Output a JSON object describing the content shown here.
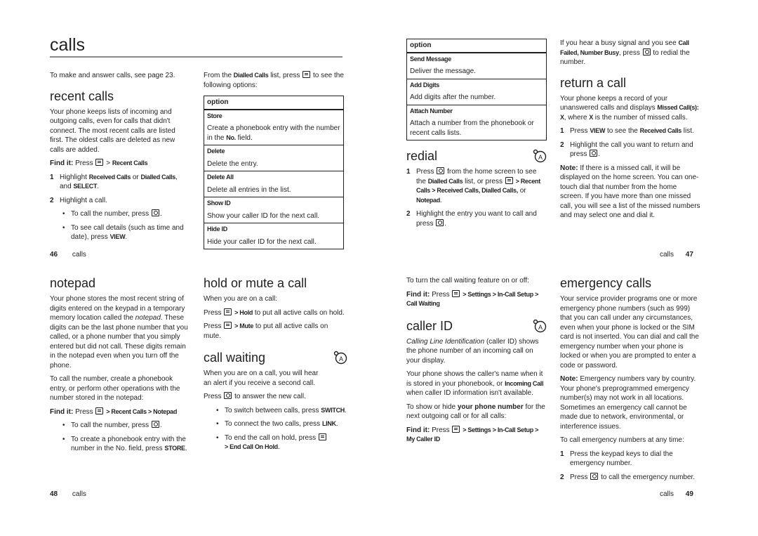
{
  "page46": {
    "title": "calls",
    "intro": "To make and answer calls, see page 23.",
    "recent_calls": {
      "heading": "recent calls",
      "body": "Your phone keeps lists of incoming and outgoing calls, even for calls that didn't connect. The most recent calls are listed first. The oldest calls are deleted as new calls are added.",
      "find_it_label": "Find it:",
      "find_it_press": "Press",
      "find_it_path": "Recent Calls",
      "step1_num": "1",
      "step1_a": "Highlight",
      "step1_b": "Received Calls",
      "step1_c": "or",
      "step1_d": "Dialled Calls",
      "step1_e": ", and",
      "step1_f": "SELECT",
      "step2_num": "2",
      "step2": "Highlight a call.",
      "bullet1": "To call the number, press",
      "bullet2_a": "To see call details (such as time and date), press",
      "bullet2_b": "VIEW"
    },
    "dialled_options": {
      "intro_a": "From the",
      "intro_b": "Dialled Calls",
      "intro_c": "list, press",
      "intro_d": "to see the following options:",
      "header": "option",
      "rows": [
        {
          "name": "Store",
          "desc_a": "Create a phonebook entry with the number in the",
          "desc_b": "No.",
          "desc_c": "field."
        },
        {
          "name": "Delete",
          "desc_a": "Delete the entry."
        },
        {
          "name": "Delete All",
          "desc_a": "Delete all entries in the list."
        },
        {
          "name": "Show ID",
          "desc_a": "Show your caller ID for the next call."
        },
        {
          "name": "Hide ID",
          "desc_a": "Hide your caller ID for the next call."
        }
      ]
    },
    "folio_num": "46",
    "folio_label": "calls"
  },
  "page47": {
    "options": {
      "header": "option",
      "rows": [
        {
          "name": "Send Message",
          "desc": "Deliver the message."
        },
        {
          "name": "Add Digits",
          "desc": "Add digits after the number."
        },
        {
          "name": "Attach Number",
          "desc": "Attach a number from the phonebook or recent calls lists."
        }
      ]
    },
    "redial": {
      "heading": "redial",
      "step1_num": "1",
      "step1_a": "Press",
      "step1_b": "from the home screen to see the",
      "step1_c": "Dialled Calls",
      "step1_d": "list, or press",
      "step1_e": "> Recent Calls > Received Calls, Dialled Calls,",
      "step1_f": "or",
      "step1_g": "Notepad",
      "step2_num": "2",
      "step2": "Highlight the entry you want to call and press"
    },
    "busy": {
      "a": "If you hear a busy signal and you see",
      "b": "Call Failed, Number Busy",
      "c": ", press",
      "d": "to redial the number."
    },
    "return_call": {
      "heading": "return a call",
      "body_a": "Your phone keeps a record of your unanswered calls and displays",
      "body_b": "Missed Call(s): X",
      "body_c": ", where",
      "body_d": "X",
      "body_e": "is the number of missed calls.",
      "step1_num": "1",
      "step1_a": "Press",
      "step1_b": "VIEW",
      "step1_c": "to see the",
      "step1_d": "Received Calls",
      "step1_e": "list.",
      "step2_num": "2",
      "step2": "Highlight the call you want to return and press",
      "note_label": "Note:",
      "note": "If there is a missed call, it will be displayed on the home screen. You can one-touch dial that number from the home screen. If you have more than one missed call, you will see a list of the missed numbers and may select one and dial it."
    },
    "folio_label": "calls",
    "folio_num": "47"
  },
  "page48": {
    "notepad": {
      "heading": "notepad",
      "body_a": "Your phone stores the most recent string of digits entered on the keypad in a temporary memory location called the",
      "body_em": "notepad",
      "body_b": ". These digits can be the last phone number that you called, or a phone number that you simply entered but did not call. These digits remain in the notepad even when you turn off the phone.",
      "body2": "To call the number, create a phonebook entry, or perform other operations with the number stored in the notepad:",
      "find_it_label": "Find it:",
      "find_it_press": "Press",
      "find_it_path": "> Recent Calls > Notepad",
      "bullet1": "To call the number, press",
      "bullet2_a": "To create a phonebook entry with the number in the No. field, press",
      "bullet2_b": "STORE"
    },
    "hold_mute": {
      "heading": "hold or mute a call",
      "intro": "When you are on a call:",
      "hold_a": "Press",
      "hold_b": "> Hold",
      "hold_c": "to put all active calls on hold.",
      "mute_a": "Press",
      "mute_b": "> Mute",
      "mute_c": "to put all active calls on mute."
    },
    "call_waiting": {
      "heading": "call waiting",
      "intro": "When you are on a call, you will hear an alert if you receive a second call.",
      "press_a": "Press",
      "press_b": "to answer the new call.",
      "bullet1_a": "To switch between calls, press",
      "bullet1_b": "SWITCH",
      "bullet2_a": "To connect the two calls, press",
      "bullet2_b": "LINK",
      "bullet3_a": "To end the call on hold, press",
      "bullet3_b": "> End Call On Hold"
    },
    "folio_num": "48",
    "folio_label": "calls"
  },
  "page49": {
    "cw_toggle": {
      "intro": "To turn the call waiting feature on or off:",
      "find_it_label": "Find it:",
      "find_it_press": "Press",
      "find_it_path": "> Settings > In-Call Setup > Call Waiting"
    },
    "caller_id": {
      "heading": "caller ID",
      "body_em": "Calling Line Identification",
      "body_a": "(caller ID) shows the phone number of an incoming call on your display.",
      "body2_a": "Your phone shows the caller's name when it is stored in your phonebook, or",
      "body2_b": "Incoming Call",
      "body2_c": "when caller ID information isn't available.",
      "body3_a": "To show or hide",
      "body3_b": "your phone number",
      "body3_c": "for the next outgoing call or for all calls:",
      "find_it_label": "Find it:",
      "find_it_press": "Press",
      "find_it_path": "> Settings > In-Call Setup > My Caller ID"
    },
    "emergency": {
      "heading": "emergency calls",
      "body": "Your service provider programs one or more emergency phone numbers (such as 999) that you can call under any circumstances, even when your phone is locked or the SIM card is not inserted. You can dial and call the emergency number when your phone is locked or when you are prompted to enter a code or password.",
      "note_label": "Note:",
      "note": "Emergency numbers vary by country. Your phone's preprogrammed emergency number(s) may not work in all locations. Sometimes an emergency call cannot be made due to network, environmental, or interference issues.",
      "intro2": "To call emergency numbers at any time:",
      "step1_num": "1",
      "step1": "Press the keypad keys to dial the emergency number.",
      "step2_num": "2",
      "step2_a": "Press",
      "step2_b": "to call the emergency number."
    },
    "folio_label": "calls",
    "folio_num": "49"
  },
  "icons": {
    "menu_key": "menu-key-icon",
    "send_key": "send-key-icon",
    "network_feature": "network-feature-icon"
  }
}
